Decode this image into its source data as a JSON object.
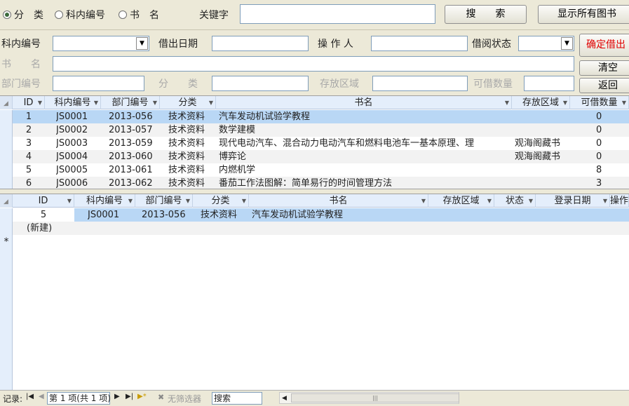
{
  "search": {
    "radio_category": "分　类",
    "radio_code": "科内编号",
    "radio_title": "书　名",
    "keyword_label": "关键字",
    "keyword_value": "",
    "search_button": "搜　　索",
    "show_all_button": "显示所有图书"
  },
  "form": {
    "code_label": "科内编号",
    "date_label": "借出日期",
    "operator_label": "操 作 人",
    "status_label": "借阅状态",
    "title_label": "书　　名",
    "dept_label": "部门编号",
    "category_label": "分　　类",
    "location_label": "存放区域",
    "qty_label": "可借数量",
    "confirm_button": "确定借出",
    "clear_button": "清空",
    "back_button": "返回"
  },
  "books_grid": {
    "headers": [
      "ID",
      "科内编号",
      "部门编号",
      "分类",
      "书名",
      "存放区域",
      "可借数量"
    ],
    "rows": [
      [
        "1",
        "JS0001",
        "2013-056",
        "技术资料",
        "汽车发动机试验学教程",
        "",
        "0"
      ],
      [
        "2",
        "JS0002",
        "2013-057",
        "技术资料",
        "数学建模",
        "",
        "0"
      ],
      [
        "3",
        "JS0003",
        "2013-059",
        "技术资料",
        "现代电动汽车、混合动力电动汽车和燃料电池车一基本原理、理",
        "观海阁藏书",
        "0"
      ],
      [
        "4",
        "JS0004",
        "2013-060",
        "技术资料",
        "博弈论",
        "观海阁藏书",
        "0"
      ],
      [
        "5",
        "JS0005",
        "2013-061",
        "技术资料",
        "内燃机学",
        "",
        "8"
      ],
      [
        "6",
        "JS0006",
        "2013-062",
        "技术资料",
        "番茄工作法图解：简单易行的时间管理方法",
        "",
        "3"
      ]
    ]
  },
  "loan_grid": {
    "headers": [
      "ID",
      "科内编号",
      "部门编号",
      "分类",
      "书名",
      "存放区域",
      "状态",
      "登录日期",
      "操作"
    ],
    "rows": [
      [
        "5",
        "JS0001",
        "2013-056",
        "技术资料",
        "汽车发动机试验学教程",
        "",
        "",
        "",
        ""
      ]
    ],
    "new_row_marker": "*",
    "new_row_label": "(新建)"
  },
  "statusbar": {
    "record_label": "记录:",
    "position": "第 1 项(共 1 项)",
    "filter": "无筛选器",
    "search_placeholder": "搜索"
  }
}
